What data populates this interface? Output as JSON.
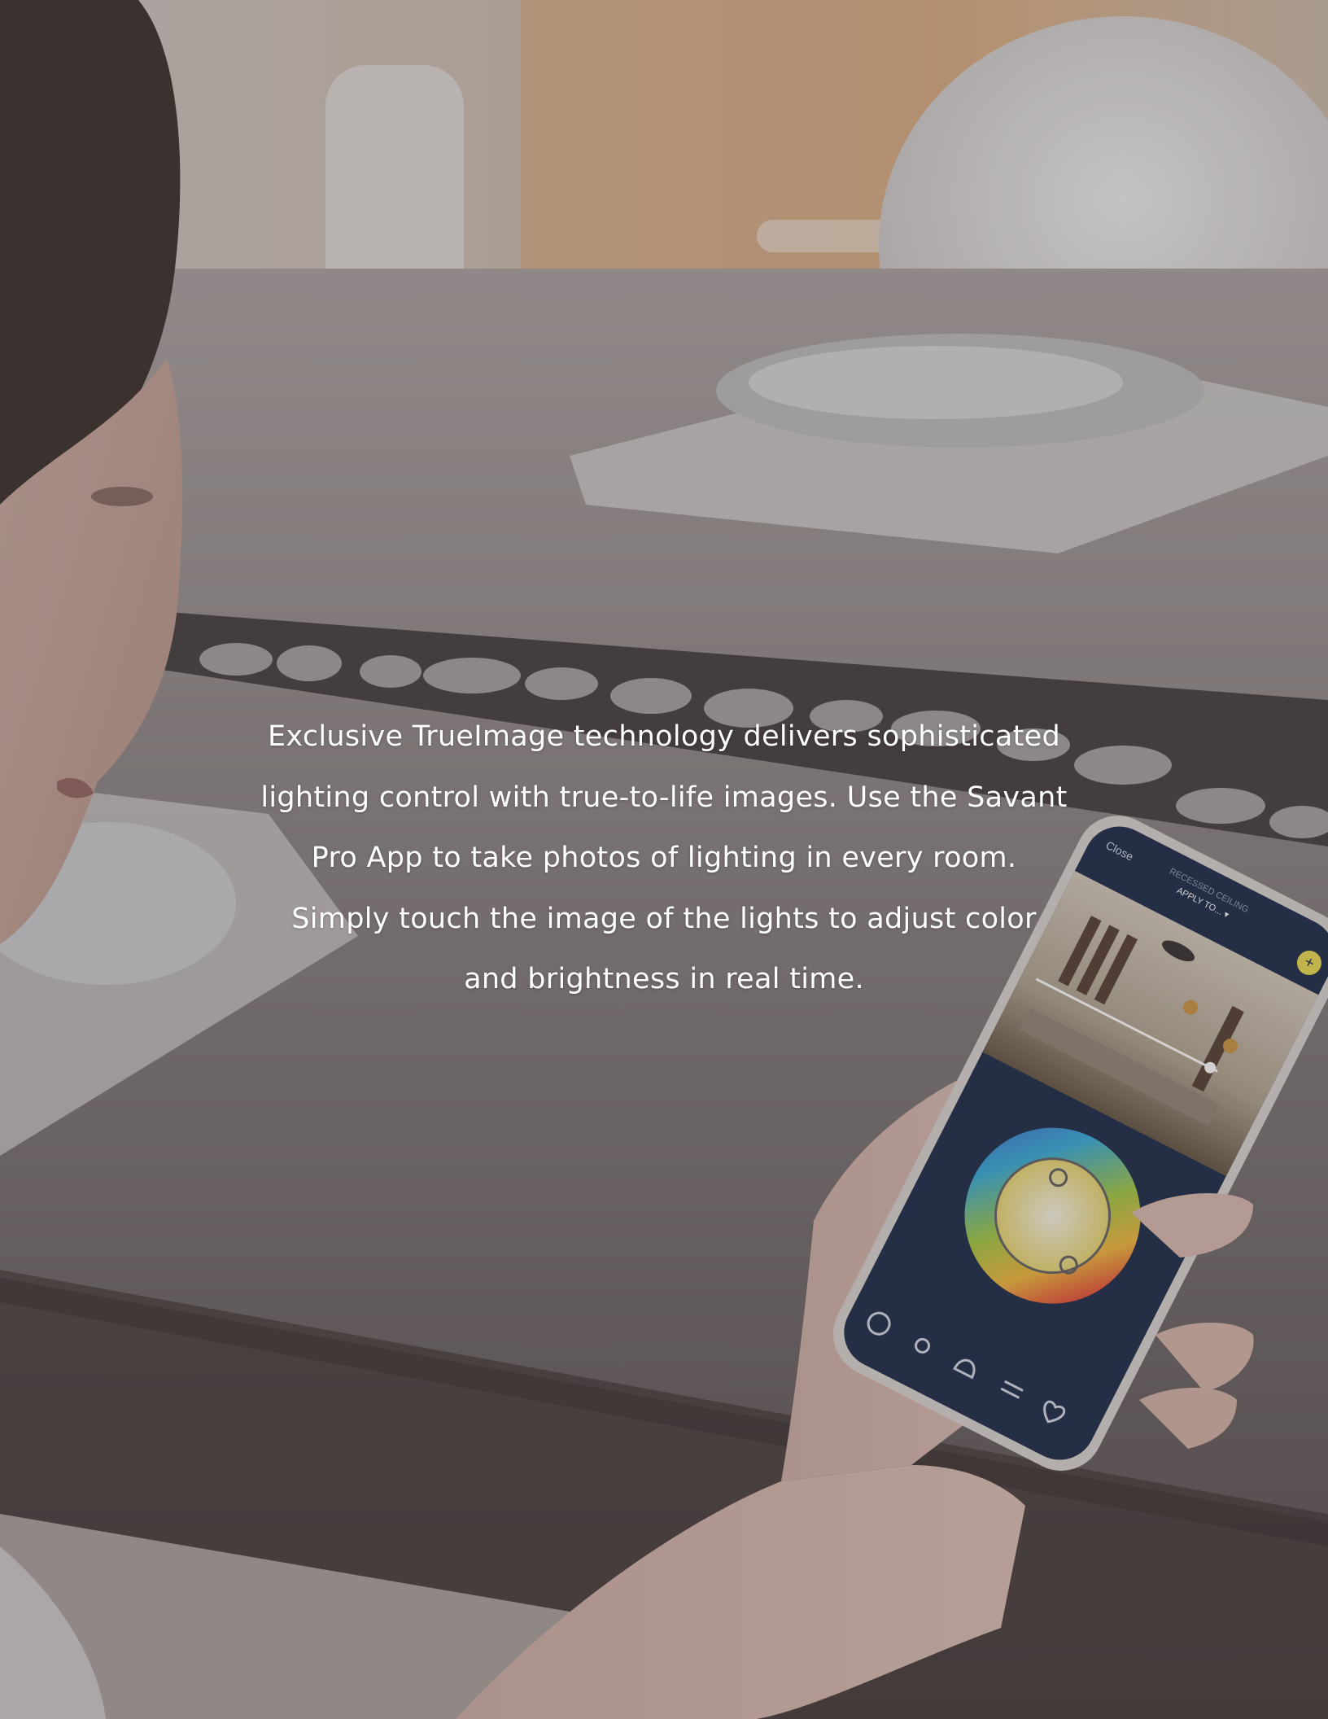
{
  "background": {
    "scene": "woman at dining table holding smartphone",
    "overlay_color": "#7a7373"
  },
  "copy": {
    "lines": [
      "Exclusive TrueImage technology delivers sophisticated",
      "lighting control with true-to-life images. Use the Savant",
      "Pro App to take photos of lighting in every room.",
      "Simply touch the image of the lights to adjust color",
      "and brightness in real time."
    ]
  },
  "phone": {
    "close_label": "Close",
    "fixture_label": "RECESSED CEILING",
    "apply_label": "APPLY TO... ▾",
    "add_icon": "plus-icon",
    "screen_color": "#0f1f3d",
    "accent_color": "#e8d84a",
    "tab_icons": [
      "target-icon",
      "sun-icon",
      "bell-icon",
      "sliders-icon",
      "heart-icon"
    ]
  }
}
